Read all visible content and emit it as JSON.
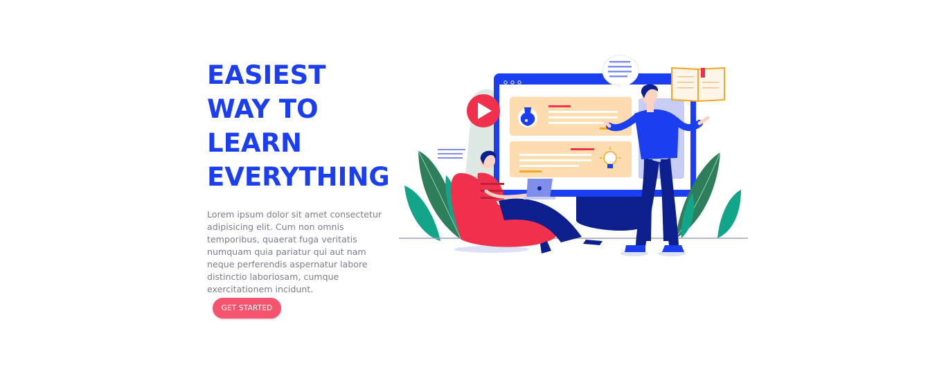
{
  "hero": {
    "title_lines": [
      "EASIEST",
      "WAY TO",
      "LEARN",
      "EVERYTHING"
    ],
    "description": "Lorem ipsum dolor sit amet consectetur adipisicing elit. Cum non omnis temporibus, quaerat fuga veritatis numquam quia pariatur qui aut nam neque perferendis aspernatur labore distinctio laboriosam, cumque exercitationem incidunt.",
    "cta_label": "GET STARTED"
  },
  "illustration": {
    "name": "online-learning-illustration",
    "icons": [
      "play-icon",
      "flask-icon",
      "lightbulb-icon",
      "open-book-icon",
      "chat-bubble-icon",
      "laptop-icon"
    ]
  },
  "colors": {
    "heading": "#1a3ef0",
    "body_text": "#7b7e8e",
    "cta_background": "#f5546f",
    "cta_text": "#ffffff",
    "monitor_frame": "#1a3ef0",
    "card_background": "#fddcb0",
    "leaf_dark": "#2e7d5b",
    "leaf_teal": "#12a58a",
    "beanbag": "#f0314d"
  }
}
